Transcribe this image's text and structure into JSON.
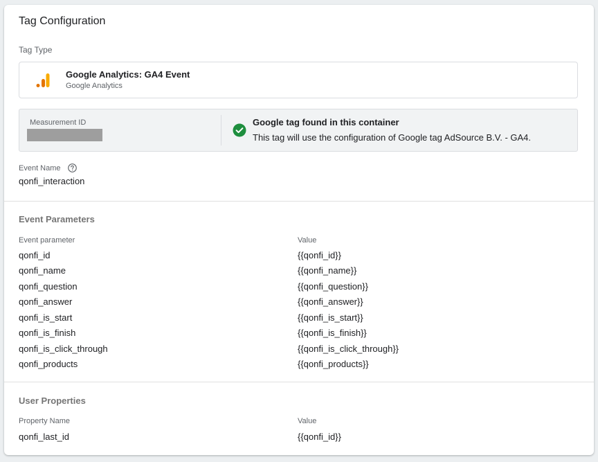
{
  "title": "Tag Configuration",
  "tag_type": {
    "label": "Tag Type",
    "name": "Google Analytics: GA4 Event",
    "sub": "Google Analytics",
    "icon": "google-analytics-icon",
    "icon_color": "#f9ab00"
  },
  "measurement": {
    "label": "Measurement ID",
    "found_title": "Google tag found in this container",
    "found_desc": "This tag will use the configuration of Google tag AdSource B.V. - GA4.",
    "check_color": "#1e8e3e"
  },
  "event_name": {
    "label": "Event Name",
    "value": "qonfi_interaction"
  },
  "event_parameters": {
    "title": "Event Parameters",
    "col_param": "Event parameter",
    "col_value": "Value",
    "rows": [
      {
        "param": "qonfi_id",
        "value": "{{qonfi_id}}"
      },
      {
        "param": "qonfi_name",
        "value": "{{qonfi_name}}"
      },
      {
        "param": "qonfi_question",
        "value": "{{qonfi_question}}"
      },
      {
        "param": "qonfi_answer",
        "value": "{{qonfi_answer}}"
      },
      {
        "param": "qonfi_is_start",
        "value": "{{qonfi_is_start}}"
      },
      {
        "param": "qonfi_is_finish",
        "value": "{{qonfi_is_finish}}"
      },
      {
        "param": "qonfi_is_click_through",
        "value": "{{qonfi_is_click_through}}"
      },
      {
        "param": "qonfi_products",
        "value": "{{qonfi_products}}"
      }
    ]
  },
  "user_properties": {
    "title": "User Properties",
    "col_name": "Property Name",
    "col_value": "Value",
    "rows": [
      {
        "name": "qonfi_last_id",
        "value": "{{qonfi_id}}"
      }
    ]
  }
}
